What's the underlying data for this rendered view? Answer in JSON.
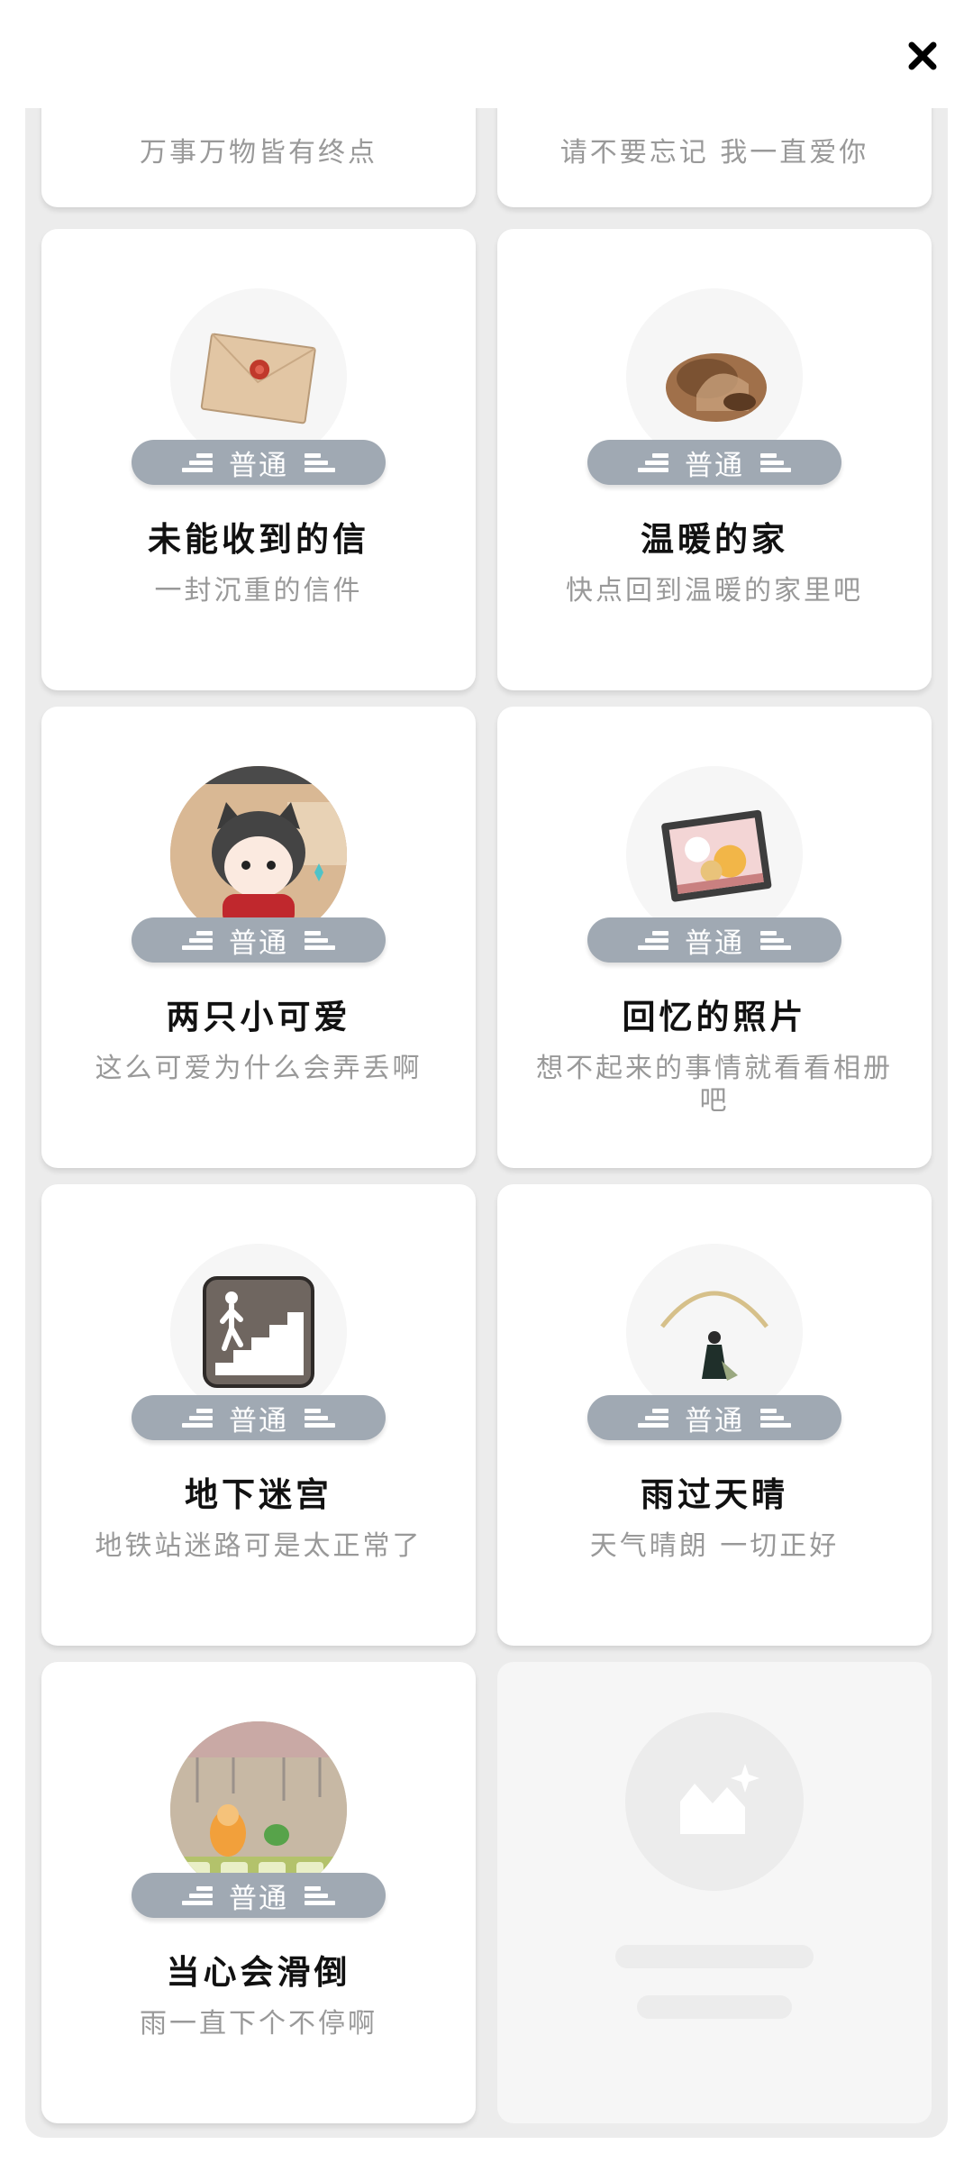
{
  "badge_label": "普通",
  "partial_row": {
    "left_desc": "万事万物皆有终点",
    "right_desc": "请不要忘记 我一直爱你"
  },
  "cards": [
    {
      "title": "未能收到的信",
      "desc": "一封沉重的信件",
      "icon": "envelope-icon"
    },
    {
      "title": "温暖的家",
      "desc": "快点回到温暖的家里吧",
      "icon": "home-stone-icon"
    },
    {
      "title": "两只小可爱",
      "desc": "这么可爱为什么会弄丢啊",
      "icon": "cat-boy-icon"
    },
    {
      "title": "回忆的照片",
      "desc": "想不起来的事情就看看相册吧",
      "icon": "photo-frame-icon"
    },
    {
      "title": "地下迷宫",
      "desc": "地铁站迷路可是太正常了",
      "icon": "stairs-down-icon"
    },
    {
      "title": "雨过天晴",
      "desc": "天气晴朗 一切正好",
      "icon": "rainbow-girl-icon"
    },
    {
      "title": "当心会滑倒",
      "desc": "雨一直下个不停啊",
      "icon": "slip-warning-icon"
    }
  ],
  "empty_slot_icon": "add-image-icon",
  "colors": {
    "badge": "#a0a9b3",
    "panel_bg": "#ececec",
    "card_bg": "#ffffff"
  }
}
